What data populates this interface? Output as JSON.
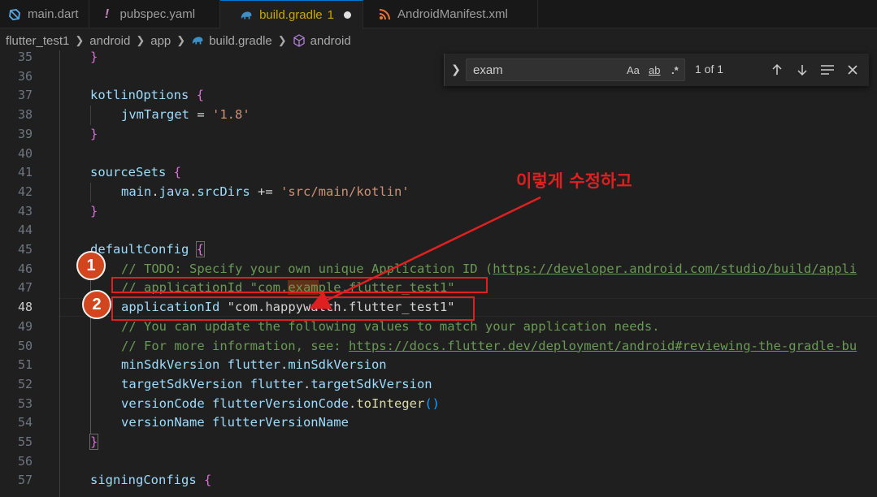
{
  "tabs": [
    {
      "label": "main.dart",
      "icon": "dart-icon"
    },
    {
      "label": "pubspec.yaml",
      "icon": "yaml-exclamation-icon"
    },
    {
      "label": "build.gradle",
      "icon": "gradle-elephant-icon",
      "badge": "1",
      "active": true,
      "modified": true
    },
    {
      "label": "AndroidManifest.xml",
      "icon": "rss-xml-icon"
    }
  ],
  "breadcrumb": [
    "flutter_test1",
    "android",
    "app",
    "build.gradle",
    "android"
  ],
  "find": {
    "value": "exam",
    "match_case": "Aa",
    "whole_word": "ab",
    "regex": ".*",
    "count": "1 of 1"
  },
  "line_numbers": [
    "35",
    "36",
    "37",
    "38",
    "39",
    "40",
    "41",
    "42",
    "43",
    "44",
    "45",
    "46",
    "47",
    "48",
    "49",
    "50",
    "51",
    "52",
    "53",
    "54",
    "55",
    "56",
    "57"
  ],
  "current_line": "48",
  "code": {
    "l35": "}",
    "l37a": "kotlinOptions ",
    "l37b": "{",
    "l38a": "jvmTarget",
    "l38b": " = ",
    "l38c": "'1.8'",
    "l39": "}",
    "l41a": "sourceSets ",
    "l41b": "{",
    "l42a": "main",
    "l42b": ".",
    "l42c": "java",
    "l42d": ".",
    "l42e": "srcDirs",
    "l42f": " += ",
    "l42g": "'src/main/kotlin'",
    "l43": "}",
    "l45a": "defaultConfig ",
    "l45b": "{",
    "l46a": "// TODO: Specify your own unique Application ID (",
    "l46b": "https://developer.android.com/studio/build/appli",
    "l47a": "// applicationId \"com.",
    "l47b": "exam",
    "l47c": "ple.flutter_test1\"",
    "l48a": "applicationId",
    "l48b": " \"com.happywatch.flutter_test1\"",
    "l49": "// You can update the following values to match your application needs.",
    "l50a": "// For more information, see: ",
    "l50b": "https://docs.flutter.dev/deployment/android#reviewing-the-gradle-bu",
    "l51a": "minSdkVersion ",
    "l51b": "flutter",
    "l51c": ".",
    "l51d": "minSdkVersion",
    "l52a": "targetSdkVersion ",
    "l52b": "flutter",
    "l52c": ".",
    "l52d": "targetSdkVersion",
    "l53a": "versionCode ",
    "l53b": "flutterVersionCode",
    "l53c": ".",
    "l53d": "toInteger",
    "l53e": "()",
    "l54a": "versionName ",
    "l54b": "flutterVersionName",
    "l55": "}",
    "l57a": "signingConfigs ",
    "l57b": "{"
  },
  "annotations": {
    "marker1": "1",
    "marker2": "2",
    "note": "이렇게 수정하고"
  },
  "colors": {
    "annotation_red": "#e02020",
    "marker_fill": "#d1461e",
    "active_tab_label": "#cca700",
    "comment": "#6a9955",
    "string": "#ce9178",
    "identifier": "#9cdcfe"
  }
}
